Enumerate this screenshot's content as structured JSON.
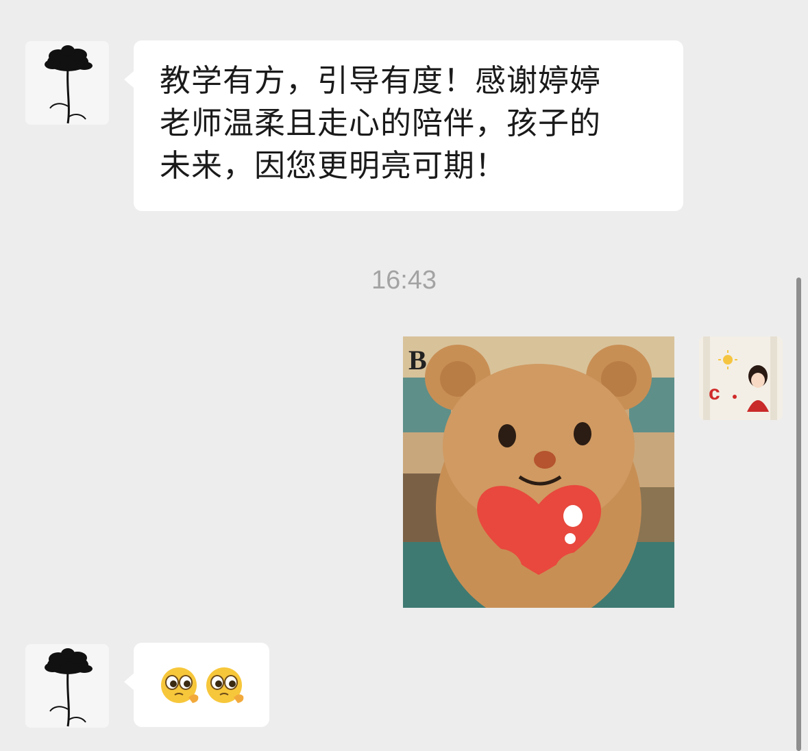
{
  "messages": [
    {
      "sender": "contact",
      "type": "text",
      "lines": [
        "教学有方，引导有度！感谢婷婷",
        "老师温柔且走心的陪伴，孩子的",
        "未来，因您更明亮可期！"
      ],
      "avatar_icon": "black-flower-icon"
    },
    {
      "type": "timestamp",
      "text": "16:43"
    },
    {
      "sender": "self",
      "type": "sticker",
      "sticker_icon": "teddy-bear-heart-icon",
      "avatar_icon": "girl-cartoon-icon"
    },
    {
      "sender": "contact",
      "type": "emoji",
      "emojis": [
        "pleading-face-icon",
        "pleading-face-icon"
      ],
      "avatar_icon": "black-flower-icon"
    }
  ],
  "colors": {
    "background": "#ededed",
    "bubble": "#ffffff",
    "text": "#1a1a1a",
    "timestamp": "#a3a3a3",
    "heart": "#e8483d"
  }
}
